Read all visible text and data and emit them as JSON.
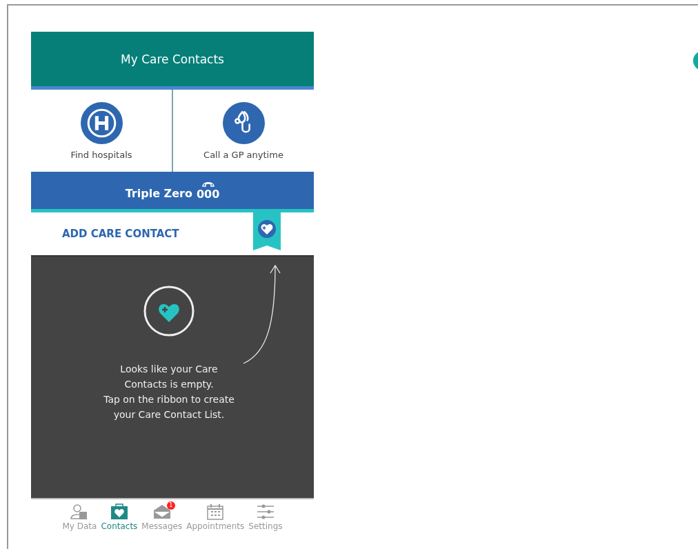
{
  "header": {
    "title": "My Care Contacts"
  },
  "quick_actions": [
    {
      "kind": "hospital",
      "label": "Find hospitals"
    },
    {
      "kind": "gp",
      "label": "Call a GP anytime"
    }
  ],
  "emergency": {
    "label": "Triple Zero",
    "number": "000"
  },
  "add_contact": {
    "label": "ADD CARE CONTACT"
  },
  "empty_state": {
    "message": "Looks like your Care\nContacts is empty.\nTap on the ribbon to create\nyour Care Contact List."
  },
  "tabs": [
    {
      "kind": "data",
      "label": "My Data",
      "selected": false
    },
    {
      "kind": "contacts",
      "label": "Contacts",
      "selected": true
    },
    {
      "kind": "messages",
      "label": "Messages",
      "selected": false,
      "badge": "1"
    },
    {
      "kind": "appointments",
      "label": "Appointments",
      "selected": false
    },
    {
      "kind": "settings",
      "label": "Settings",
      "selected": false
    }
  ]
}
